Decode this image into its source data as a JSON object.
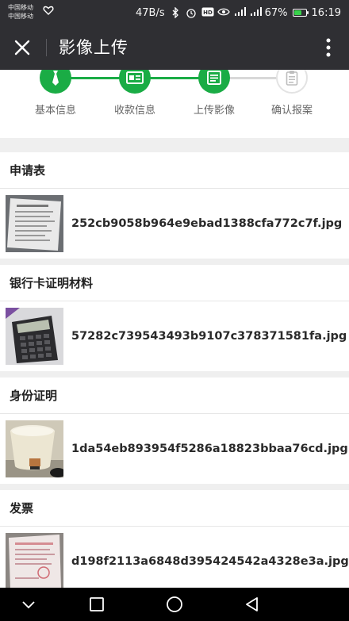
{
  "status_bar": {
    "carrier_line_1": "中国移动",
    "carrier_line_2": "中国移动",
    "speed": "47B/s",
    "icons": [
      "heart-icon",
      "bluetooth-icon",
      "alarm-icon",
      "hd-icon",
      "eye-icon",
      "signal-icon",
      "signal-icon"
    ],
    "battery_percent": "67%",
    "battery_level": 0.67,
    "time": "16:19",
    "colors": {
      "bar_bg": "#2f2f33",
      "battery": "#38d14b"
    }
  },
  "app_bar": {
    "title": "影像上传",
    "icons": [
      "close-icon",
      "more-vertical-icon"
    ]
  },
  "stepper": {
    "active_color": "#1aac45",
    "steps": [
      {
        "label": "基本信息",
        "state": "done",
        "icon": "tie-icon"
      },
      {
        "label": "收款信息",
        "state": "done",
        "icon": "id-card-icon"
      },
      {
        "label": "上传影像",
        "state": "done",
        "icon": "document-icon"
      },
      {
        "label": "确认报案",
        "state": "todo",
        "icon": "clipboard-icon"
      }
    ]
  },
  "sections": [
    {
      "title": "申请表",
      "file": "252cb9058b964e9ebad1388cfa772c7f.jpg",
      "thumb_icon": "form-photo-thumbnail"
    },
    {
      "title": "银行卡证明材料",
      "file": "57282c739543493b9107c378371581fa.jpg",
      "thumb_icon": "calculator-photo-thumbnail"
    },
    {
      "title": "身份证明",
      "file": "1da54eb893954f5286a18823bbaa76cd.jpg",
      "thumb_icon": "cup-photo-thumbnail"
    },
    {
      "title": "发票",
      "file": "d198f2113a6848d395424542a4328e3a.jpg",
      "thumb_icon": "invoice-photo-thumbnail"
    }
  ],
  "nav_bar": {
    "icons": [
      "chevron-down-icon",
      "square-icon",
      "circle-icon",
      "triangle-back-icon"
    ]
  }
}
